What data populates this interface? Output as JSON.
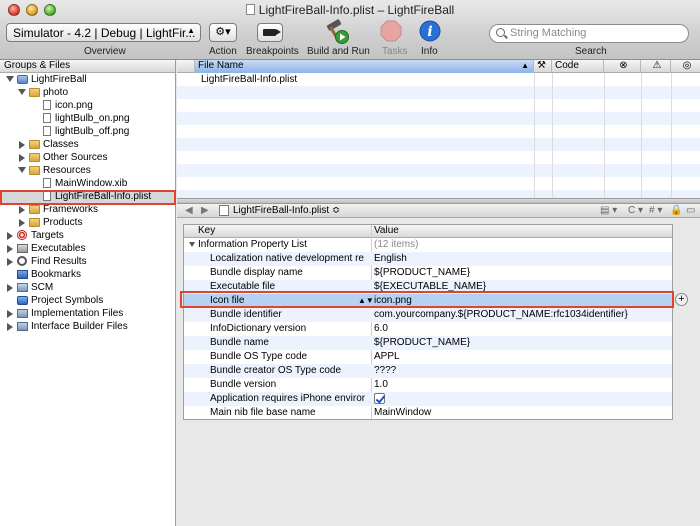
{
  "window": {
    "title": "LightFireBall-Info.plist – LightFireBall"
  },
  "toolbar": {
    "overview_value": "Simulator - 4.2 | Debug | LightFir...",
    "overview_label": "Overview",
    "action_label": "Action",
    "breakpoints_label": "Breakpoints",
    "build_run_label": "Build and Run",
    "tasks_label": "Tasks",
    "info_label": "Info",
    "search_placeholder": "String Matching",
    "search_label": "Search"
  },
  "sidebar": {
    "header": "Groups & Files",
    "items": [
      {
        "label": "LightFireBall"
      },
      {
        "label": "photo"
      },
      {
        "label": "icon.png"
      },
      {
        "label": "lightBulb_on.png"
      },
      {
        "label": "lightBulb_off.png"
      },
      {
        "label": "Classes"
      },
      {
        "label": "Other Sources"
      },
      {
        "label": "Resources"
      },
      {
        "label": "MainWindow.xib"
      },
      {
        "label": "LightFireBall-Info.plist"
      },
      {
        "label": "Frameworks"
      },
      {
        "label": "Products"
      },
      {
        "label": "Targets"
      },
      {
        "label": "Executables"
      },
      {
        "label": "Find Results"
      },
      {
        "label": "Bookmarks"
      },
      {
        "label": "SCM"
      },
      {
        "label": "Project Symbols"
      },
      {
        "label": "Implementation Files"
      },
      {
        "label": "Interface Builder Files"
      }
    ]
  },
  "filelist": {
    "col_filename": "File Name",
    "col_code": "Code",
    "rows": [
      "LightFireBall-Info.plist"
    ]
  },
  "navbar": {
    "file": "LightFireBall-Info.plist ≎"
  },
  "plist": {
    "col_key": "Key",
    "col_value": "Value",
    "root_key": "Information Property List",
    "root_value": "(12 items)",
    "rows": [
      {
        "key": "Localization native development re",
        "value": "English"
      },
      {
        "key": "Bundle display name",
        "value": "${PRODUCT_NAME}"
      },
      {
        "key": "Executable file",
        "value": "${EXECUTABLE_NAME}"
      },
      {
        "key": "Icon file",
        "value": "icon.png"
      },
      {
        "key": "Bundle identifier",
        "value": "com.yourcompany.${PRODUCT_NAME:rfc1034identifier}"
      },
      {
        "key": "InfoDictionary version",
        "value": "6.0"
      },
      {
        "key": "Bundle name",
        "value": "${PRODUCT_NAME}"
      },
      {
        "key": "Bundle OS Type code",
        "value": "APPL"
      },
      {
        "key": "Bundle creator OS Type code",
        "value": "????"
      },
      {
        "key": "Bundle version",
        "value": "1.0"
      },
      {
        "key": "Application requires iPhone enviror",
        "value": ""
      },
      {
        "key": "Main nib file base name",
        "value": "MainWindow"
      }
    ]
  },
  "colors": {
    "highlight": "#e0442f",
    "selection": "#b5d2f2"
  }
}
